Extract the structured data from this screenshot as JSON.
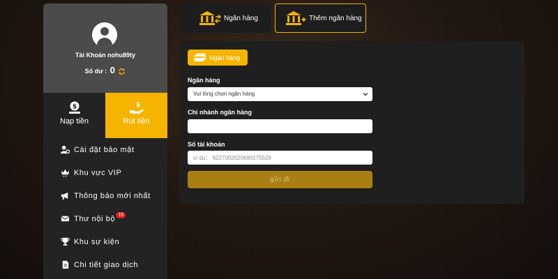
{
  "profile": {
    "account_label": "Tài Khoản nohu89ty",
    "balance_label": "Số dư :",
    "balance_value": "0"
  },
  "actions": {
    "deposit_label": "Nạp tiền",
    "withdraw_label": "Rút tiền"
  },
  "sidebar": {
    "items": [
      {
        "label": "Cài đặt bảo mật",
        "icon": "user-gear-icon"
      },
      {
        "label": "Khu vực VIP",
        "icon": "vip-crown-icon"
      },
      {
        "label": "Thông báo mới nhất",
        "icon": "megaphone-icon"
      },
      {
        "label": "Thư nội bộ",
        "icon": "envelope-icon",
        "badge": "15"
      },
      {
        "label": "Khu sự kiện",
        "icon": "trophy-icon"
      },
      {
        "label": "Chi tiết giao dịch",
        "icon": "document-icon"
      }
    ]
  },
  "tabs": {
    "bank_label": "Ngân hàng",
    "add_bank_label": "Thêm ngân hàng"
  },
  "form": {
    "pill_label": "Ngân hàng",
    "bank_label": "Ngân hàng",
    "bank_select_value": "Vui lòng chọn ngân hàng",
    "branch_label": "Chi nhánh ngân hàng",
    "branch_value": "",
    "account_number_label": "Số tài khoản",
    "account_number_placeholder": "ví dụ： 6227002020690175526",
    "submit_label": "gửi đi"
  },
  "colors": {
    "accent": "#f4b400",
    "submit": "#a87f12",
    "badge": "#e02020",
    "panel": "#1f1f1f"
  }
}
